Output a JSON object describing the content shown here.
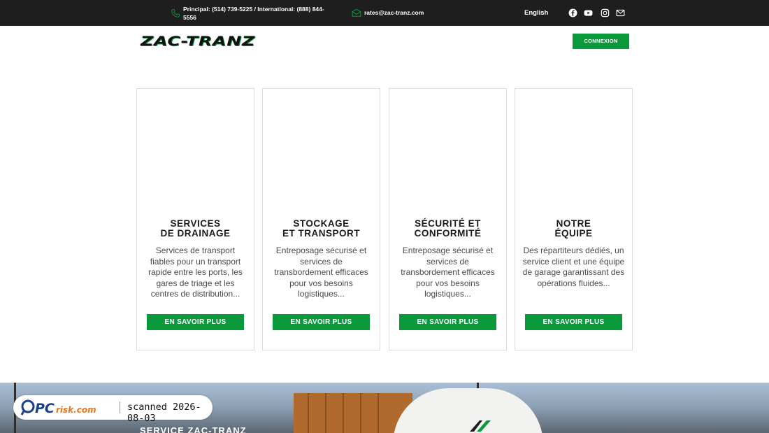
{
  "topbar": {
    "phone_text": "Principal: (514) 739-5225 / International: (888) 844-5556",
    "email_text": "rates@zac-tranz.com",
    "language_label": "English",
    "social_icons": [
      "facebook-icon",
      "youtube-icon",
      "instagram-icon",
      "envelope-icon"
    ]
  },
  "header": {
    "logo_text": "ZAC-TRANZ",
    "login_label": "CONNEXION"
  },
  "cards": [
    {
      "title_line1": "SERVICES",
      "title_line2": "DE DRAINAGE",
      "description": "Services de transport fiables pour un transport rapide entre les ports, les gares de triage et les centres de distribution...",
      "button_label": "EN SAVOIR PLUS"
    },
    {
      "title_line1": "STOCKAGE",
      "title_line2": "ET TRANSPORT",
      "description": "Entreposage sécurisé et services de transbordement efficaces pour vos besoins logistiques...",
      "button_label": "EN SAVOIR PLUS"
    },
    {
      "title_line1": "SÉCURITÉ ET",
      "title_line2": "CONFORMITÉ",
      "description": "Entreposage sécurisé et services de transbordement efficaces pour vos besoins logistiques...",
      "button_label": "EN SAVOIR PLUS"
    },
    {
      "title_line1": "NOTRE",
      "title_line2": "ÉQUIPE",
      "description": "Des répartiteurs dédiés, un service client et une équipe de garage garantissant des opérations fluides...",
      "button_label": "EN SAVOIR PLUS"
    }
  ],
  "hero": {
    "title": "SERVICE ZAC-TRANZ"
  },
  "watermark": {
    "brand": "PCrisk.com",
    "scan_text": "scanned 2026-08-03"
  },
  "colors": {
    "topbar_bg": "#1e1e1e",
    "accent_green": "#0a9a3c"
  }
}
